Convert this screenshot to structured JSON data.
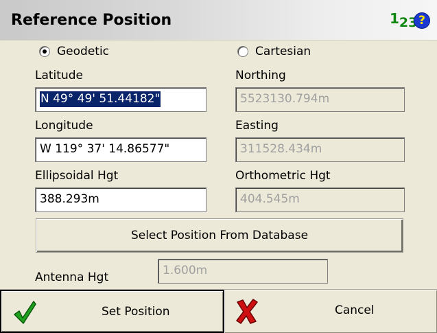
{
  "header": {
    "title": "Reference Position",
    "input_mode": {
      "main": "1",
      "sub1": "2",
      "sub2": "3"
    },
    "help_label": "?"
  },
  "coordinate_type": {
    "geodetic_label": "Geodetic",
    "cartesian_label": "Cartesian",
    "selected": "Geodetic"
  },
  "geodetic": {
    "latitude_label": "Latitude",
    "latitude_value": "N 49° 49' 51.44182\"",
    "longitude_label": "Longitude",
    "longitude_value": "W 119° 37' 14.86577\"",
    "ellipsoidal_label": "Ellipsoidal Hgt",
    "ellipsoidal_value": "388.293m"
  },
  "cartesian": {
    "northing_label": "Northing",
    "northing_value": "5523130.794m",
    "easting_label": "Easting",
    "easting_value": "311528.434m",
    "orthometric_label": "Orthometric Hgt",
    "orthometric_value": "404.545m"
  },
  "database_button_label": "Select Position From Database",
  "antenna": {
    "label": "Antenna Hgt",
    "value": "1.600m"
  },
  "footer": {
    "set_label": "Set Position",
    "cancel_label": "Cancel"
  },
  "colors": {
    "background": "#ece9d8",
    "selection": "#0a246a",
    "check_green": "#1fa01f",
    "cancel_red": "#d01010",
    "help_blue": "#1d3ad0",
    "input_mode_green": "#118811"
  },
  "icons": {
    "set": "check-icon",
    "cancel": "x-icon",
    "help": "help-icon"
  }
}
